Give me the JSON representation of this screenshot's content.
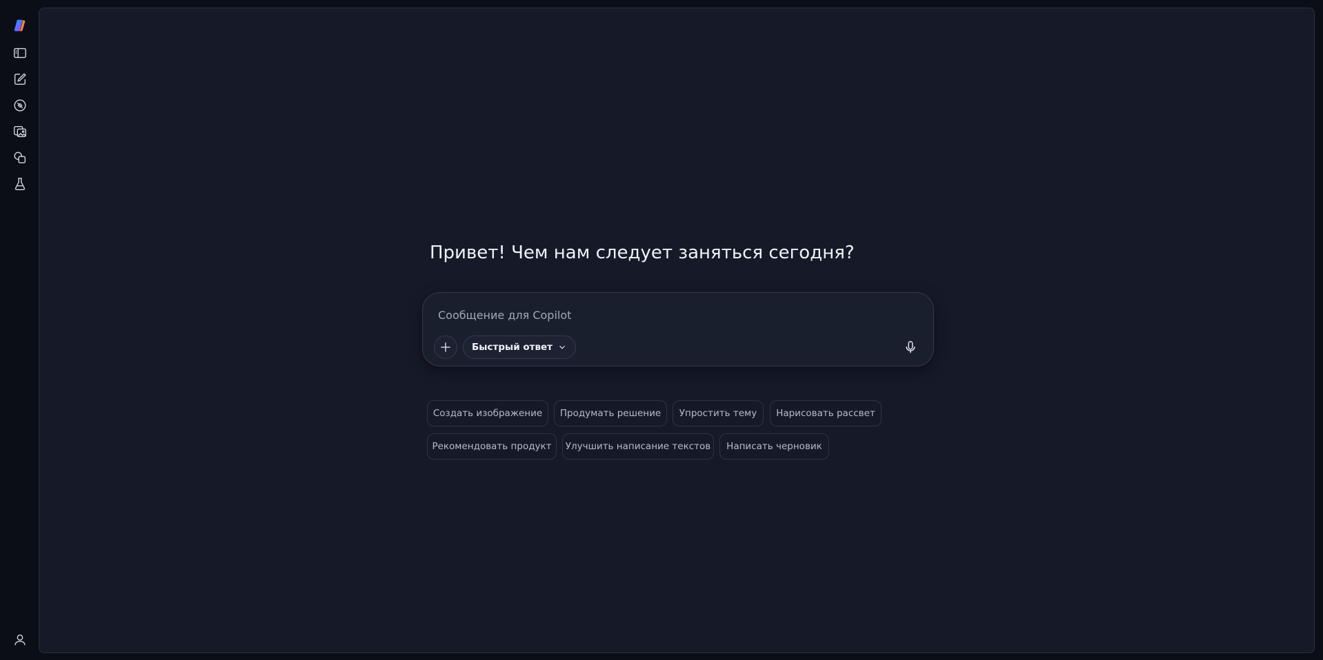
{
  "sidebar": {
    "items": [
      {
        "icon": "copilot-logo-icon",
        "name": "copilot-logo"
      },
      {
        "icon": "sidebar-toggle-icon",
        "name": "sidebar-toggle-button"
      },
      {
        "icon": "new-chat-icon",
        "name": "new-chat-button"
      },
      {
        "icon": "discover-icon",
        "name": "discover-button"
      },
      {
        "icon": "image-gallery-icon",
        "name": "images-button"
      },
      {
        "icon": "pages-icon",
        "name": "pages-button"
      },
      {
        "icon": "labs-icon",
        "name": "labs-button"
      }
    ],
    "profile_icon": "user-profile-icon"
  },
  "main": {
    "greeting": "Привет! Чем нам следует заняться сегодня?",
    "composer": {
      "placeholder": "Сообщение для Copilot",
      "mode_label": "Быстрый ответ"
    },
    "suggestions_row1": [
      "Создать изображение",
      "Продумать решение",
      "Упростить тему",
      "Нарисовать рассвет"
    ],
    "suggestions_row2": [
      "Рекомендовать продукт",
      "Улучшить написание текстов",
      "Написать черновик"
    ]
  },
  "colors": {
    "background": "#0b0e16",
    "panel": "#161a28",
    "composer": "#1a1f2e",
    "text": "#f0f2f7",
    "muted_text": "#b7bcc8"
  }
}
